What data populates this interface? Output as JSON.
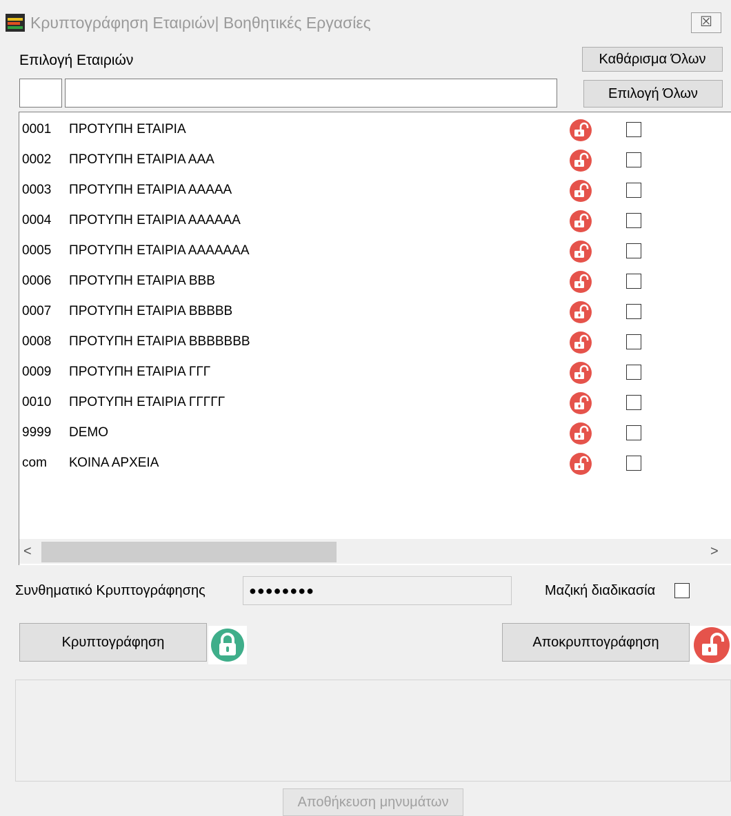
{
  "window": {
    "title": "Κρυπτογράφηση Εταιριών| Βοηθητικές Εργασίες",
    "close_label": "☒"
  },
  "header": {
    "select_label": "Επιλογή Εταιριών",
    "clear_all_label": "Καθάρισμα Όλων",
    "select_all_label": "Επιλογή Όλων",
    "code_filter": "",
    "name_filter": ""
  },
  "companies": [
    {
      "code": "0001",
      "name": "ΠΡΟΤΥΠΗ ΕΤΑΙΡΙΑ",
      "locked": false,
      "checked": false
    },
    {
      "code": "0002",
      "name": "ΠΡΟΤΥΠΗ ΕΤΑΙΡΙΑ ΑΑΑ",
      "locked": false,
      "checked": false
    },
    {
      "code": "0003",
      "name": "ΠΡΟΤΥΠΗ ΕΤΑΙΡΙΑ ΑΑΑΑΑ",
      "locked": false,
      "checked": false
    },
    {
      "code": "0004",
      "name": "ΠΡΟΤΥΠΗ ΕΤΑΙΡΙΑ ΑΑΑΑΑΑ",
      "locked": false,
      "checked": false
    },
    {
      "code": "0005",
      "name": "ΠΡΟΤΥΠΗ ΕΤΑΙΡΙΑ ΑΑΑΑΑΑΑ",
      "locked": false,
      "checked": false
    },
    {
      "code": "0006",
      "name": "ΠΡΟΤΥΠΗ ΕΤΑΙΡΙΑ ΒΒΒ",
      "locked": false,
      "checked": false
    },
    {
      "code": "0007",
      "name": "ΠΡΟΤΥΠΗ ΕΤΑΙΡΙΑ ΒΒΒΒΒ",
      "locked": false,
      "checked": false
    },
    {
      "code": "0008",
      "name": "ΠΡΟΤΥΠΗ ΕΤΑΙΡΙΑ ΒΒΒΒΒΒΒ",
      "locked": false,
      "checked": false
    },
    {
      "code": "0009",
      "name": "ΠΡΟΤΥΠΗ ΕΤΑΙΡΙΑ ΓΓΓ",
      "locked": false,
      "checked": false
    },
    {
      "code": "0010",
      "name": "ΠΡΟΤΥΠΗ ΕΤΑΙΡΙΑ ΓΓΓΓΓ",
      "locked": false,
      "checked": false
    },
    {
      "code": "9999",
      "name": "DEMO",
      "locked": false,
      "checked": false
    },
    {
      "code": "com",
      "name": "ΚΟΙΝΑ ΑΡΧΕΙΑ",
      "locked": false,
      "checked": false
    }
  ],
  "scrollbar": {
    "left_arrow": "<",
    "right_arrow": ">"
  },
  "password": {
    "label": "Συνθηματικό Κρυπτογράφησης",
    "value": "●●●●●●●●"
  },
  "bulk": {
    "label": "Μαζική διαδικασία",
    "checked": false
  },
  "actions": {
    "encrypt_label": "Κρυπτογράφηση",
    "decrypt_label": "Αποκρυπτογράφηση",
    "save_messages_label": "Αποθήκευση μηνυμάτων"
  },
  "colors": {
    "unlock_red": "#e5534b",
    "lock_green": "#3fae8a",
    "window_bg": "#f0f0f0"
  },
  "icons": {
    "unlocked": "unlocked-padlock-icon",
    "locked": "locked-padlock-icon"
  }
}
